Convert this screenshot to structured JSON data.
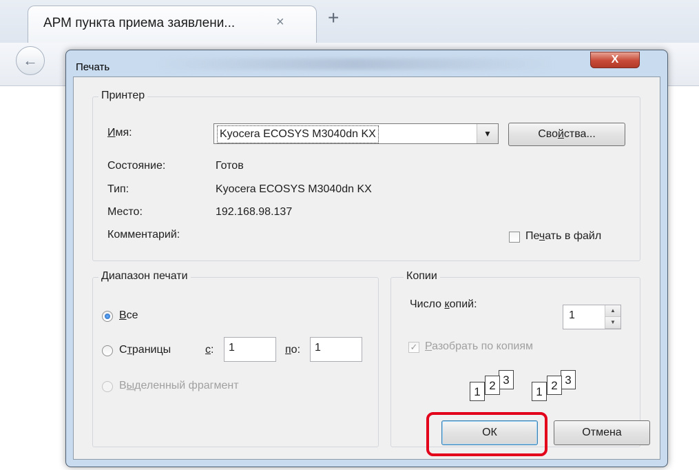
{
  "browser": {
    "tab_title": "АРМ пункта приема заявлени...",
    "tab_close": "×",
    "new_tab": "+",
    "back": "←"
  },
  "dialog": {
    "title": "Печать",
    "close": "X",
    "printer": {
      "legend": "Принтер",
      "name_label": "Имя:",
      "name_value": "Kyocera ECOSYS M3040dn KX",
      "dropdown_arrow": "▼",
      "properties_button": "Свойства...",
      "status_label": "Состояние:",
      "status_value": "Готов",
      "type_label": "Тип:",
      "type_value": "Kyocera ECOSYS M3040dn KX",
      "location_label": "Место:",
      "location_value": "192.168.98.137",
      "comment_label": "Комментарий:",
      "print_to_file_label": "Печать в файл",
      "print_to_file_checked": false
    },
    "range": {
      "legend": "Диапазон печати",
      "all_label": "Все",
      "pages_label": "Страницы",
      "from_label": "с:",
      "from_value": "1",
      "to_label": "по:",
      "to_value": "1",
      "selection_label": "Выделенный фрагмент",
      "selected_option": "all"
    },
    "copies": {
      "legend": "Копии",
      "count_label": "Число копий:",
      "count_value": "1",
      "spin_up": "▲",
      "spin_down": "▼",
      "collate_label": "Разобрать по копиям",
      "collate_checked": true,
      "collate_mark": "✓",
      "page_numbers": [
        "1",
        "2",
        "3"
      ]
    },
    "buttons": {
      "ok": "ОК",
      "cancel": "Отмена"
    }
  },
  "colors": {
    "highlight": "#e3001b",
    "dialog_frame": "#c9dbee",
    "close_button": "#c74a37",
    "radio_dot": "#1a5fb4"
  }
}
